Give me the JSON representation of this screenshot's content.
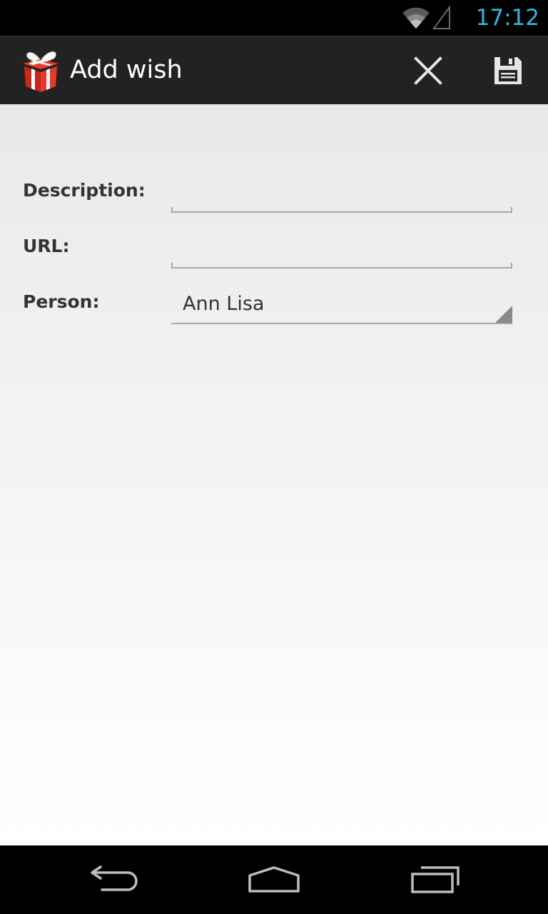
{
  "status_bar": {
    "time": "17:12",
    "icons": [
      "wifi-icon",
      "signal-icon"
    ],
    "time_color": "#33b5e5"
  },
  "action_bar": {
    "title": "Add wish",
    "app_icon": "gift-icon",
    "actions": [
      {
        "name": "cancel",
        "icon": "close-icon"
      },
      {
        "name": "save",
        "icon": "floppy-disk-icon"
      }
    ],
    "background": "#222222"
  },
  "form": {
    "description": {
      "label": "Description:",
      "value": "",
      "placeholder": ""
    },
    "url": {
      "label": "URL:",
      "value": "",
      "placeholder": ""
    },
    "person": {
      "label": "Person:",
      "selected": "Ann Lisa"
    }
  },
  "nav_bar": {
    "buttons": [
      "back-icon",
      "home-icon",
      "recent-apps-icon"
    ]
  }
}
